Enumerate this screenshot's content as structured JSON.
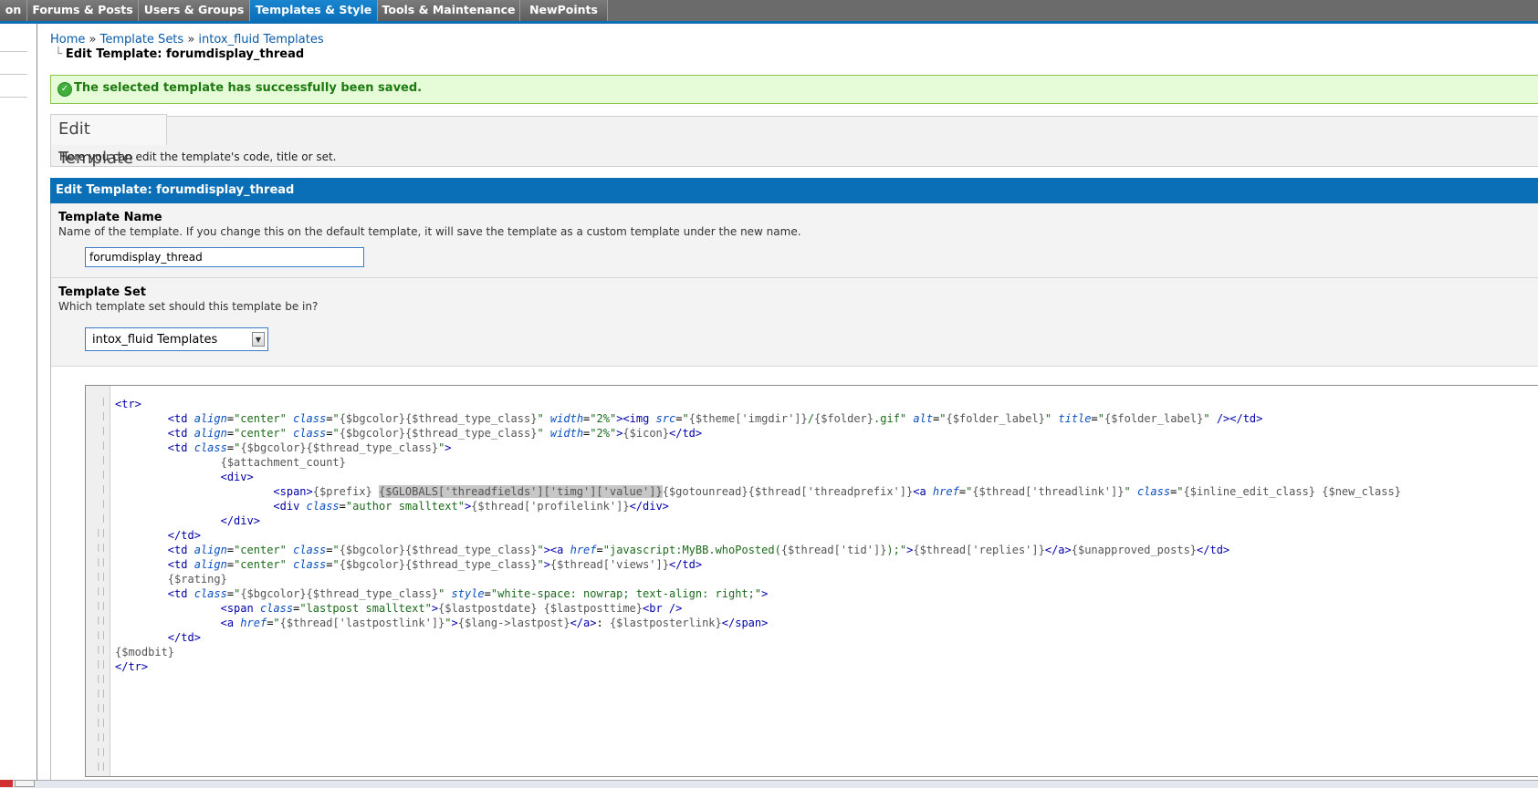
{
  "nav": {
    "tabs": [
      {
        "label": "on",
        "active": false
      },
      {
        "label": "Forums & Posts",
        "active": false
      },
      {
        "label": "Users & Groups",
        "active": false
      },
      {
        "label": "Templates & Style",
        "active": true
      },
      {
        "label": "Tools & Maintenance",
        "active": false
      },
      {
        "label": "NewPoints",
        "active": false
      }
    ]
  },
  "breadcrumb": {
    "home": "Home",
    "sep": " » ",
    "template_sets": "Template Sets",
    "template_group": "intox_fluid Templates",
    "current": "Edit Template: forumdisplay_thread"
  },
  "success_message": "The selected template has successfully been saved.",
  "page": {
    "tab_title": "Edit Template",
    "description": "Here you can edit the template's code, title or set."
  },
  "form": {
    "header": "Edit Template: forumdisplay_thread",
    "name_label": "Template Name",
    "name_desc": "Name of the template. If you change this on the default template, it will save the template as a custom template under the new name.",
    "name_value": "forumdisplay_thread",
    "set_label": "Template Set",
    "set_desc": "Which template set should this template be in?",
    "set_value": "intox_fluid Templates"
  },
  "colors": {
    "nav_bg": "#6b6b6b",
    "nav_active": "#0a6fb7",
    "success_bg": "#e6fbd8",
    "success_text": "#1d7a10",
    "form_header": "#0a6fb7"
  },
  "icons": {
    "success": "check-circle-icon",
    "dropdown": "chevron-down-icon"
  }
}
